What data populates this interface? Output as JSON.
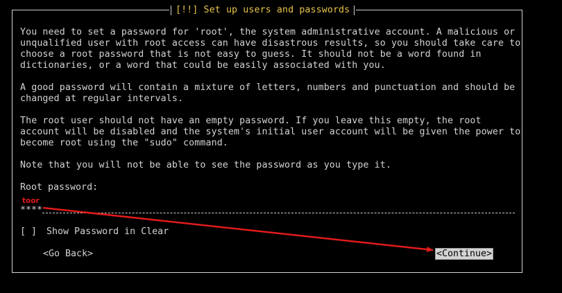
{
  "dialog": {
    "title": "[!!] Set up users and passwords",
    "paragraphs": [
      "You need to set a password for 'root', the system administrative account. A malicious or\nunqualified user with root access can have disastrous results, so you should take care to\nchoose a root password that is not easy to guess. It should not be a word found in\ndictionaries, or a word that could be easily associated with you.",
      "A good password will contain a mixture of letters, numbers and punctuation and should be\nchanged at regular intervals.",
      "The root user should not have an empty password. If you leave this empty, the root\naccount will be disabled and the system's initial user account will be given the power to\nbecome root using the \"sudo\" command.",
      "Note that you will not be able to see the password as you type it."
    ],
    "root_password_label": "Root password:",
    "password_masked": "****",
    "show_password_checkbox": "[ ]",
    "show_password_label": "Show Password in Clear",
    "go_back_button": "<Go Back>",
    "continue_button": "<Continue>"
  },
  "annotation": {
    "label": "toor",
    "color": "#e11b1b"
  },
  "colors": {
    "background": "#000000",
    "text": "#d3d3d3",
    "title": "#e6c34a",
    "button_highlight_bg": "#d3d3d3",
    "annotation_red": "#e11b1b"
  }
}
